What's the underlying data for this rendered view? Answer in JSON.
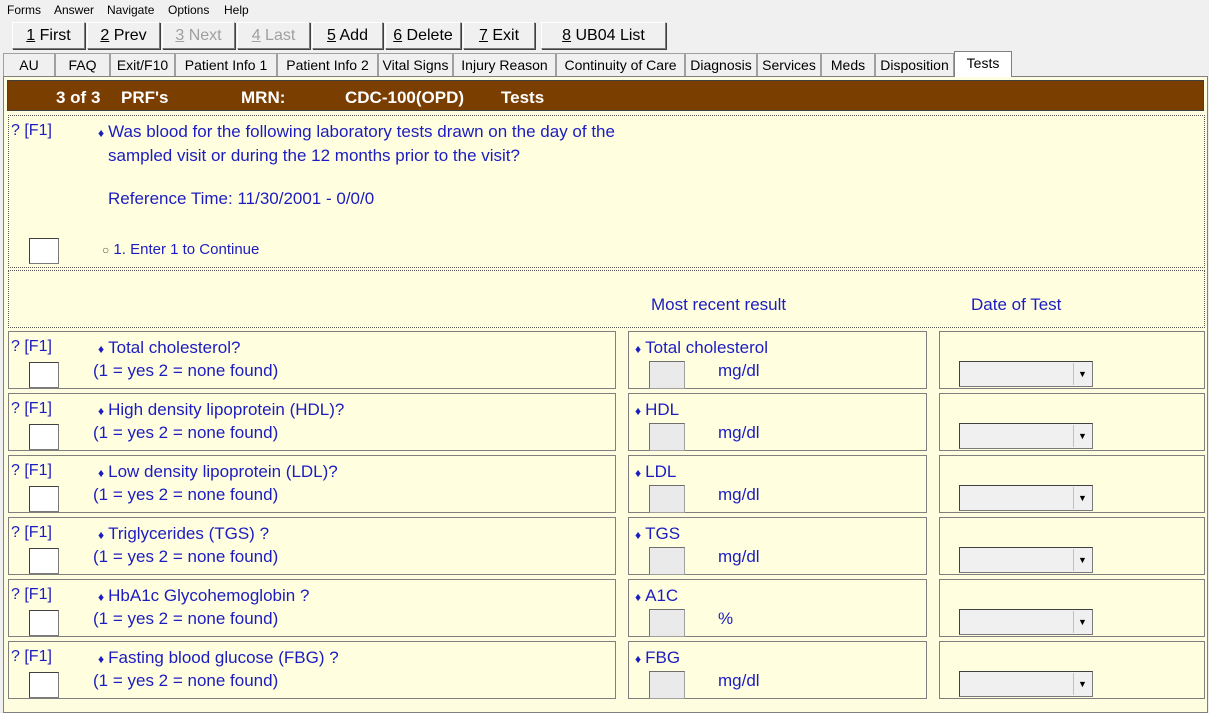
{
  "menu": [
    "Forms",
    "Answer",
    "Navigate",
    "Options",
    "Help"
  ],
  "toolbar": {
    "buttons": [
      {
        "key": "1",
        "label": " First"
      },
      {
        "key": "2",
        "label": " Prev"
      },
      {
        "key": "3",
        "label": " Next"
      },
      {
        "key": "4",
        "label": " Last"
      },
      {
        "key": "5",
        "label": " Add"
      },
      {
        "key": "6",
        "label": " Delete"
      },
      {
        "key": "7",
        "label": " Exit"
      },
      {
        "key": "8",
        "label": " UB04 List"
      }
    ]
  },
  "tabs": [
    "AU",
    "FAQ",
    "Exit/F10",
    "Patient Info 1",
    "Patient Info 2",
    "Vital Signs",
    "Injury Reason",
    "Continuity of Care",
    "Diagnosis",
    "Services",
    "Meds",
    "Disposition",
    "Tests"
  ],
  "header": {
    "record": "3 of 3",
    "prf": "PRF's",
    "mrn_label": "MRN:",
    "mrn_value": "CDC-100(OPD)",
    "section": "Tests"
  },
  "main_question": {
    "help": "? [F1]",
    "line1": "Was blood for the following laboratory tests drawn on the day of the",
    "line2": "sampled visit or during the 12 months prior to the visit?",
    "reference": "Reference Time:  11/30/2001 - 0/0/0",
    "option": "1. Enter 1 to Continue"
  },
  "columns": {
    "result": "Most recent result",
    "date": "Date of Test"
  },
  "tests": [
    {
      "question": "Total cholesterol?",
      "hint": "(1 = yes     2 = none found)",
      "result_label": "Total cholesterol",
      "unit": "mg/dl"
    },
    {
      "question": "High density lipoprotein (HDL)?",
      "hint": "(1 = yes     2 = none found)",
      "result_label": "HDL",
      "unit": "mg/dl"
    },
    {
      "question": "Low density lipoprotein (LDL)?",
      "hint": "(1 = yes     2 = none found)",
      "result_label": "LDL",
      "unit": "mg/dl"
    },
    {
      "question": "Triglycerides (TGS) ?",
      "hint": "(1 = yes     2 = none found)",
      "result_label": "TGS",
      "unit": "mg/dl"
    },
    {
      "question": "HbA1c Glycohemoglobin ?",
      "hint": "(1 = yes     2 = none found)",
      "result_label": "A1C",
      "unit": "%"
    },
    {
      "question": "Fasting blood glucose (FBG) ?",
      "hint": "(1 = yes     2 = none found)",
      "result_label": "FBG",
      "unit": "mg/dl"
    }
  ]
}
